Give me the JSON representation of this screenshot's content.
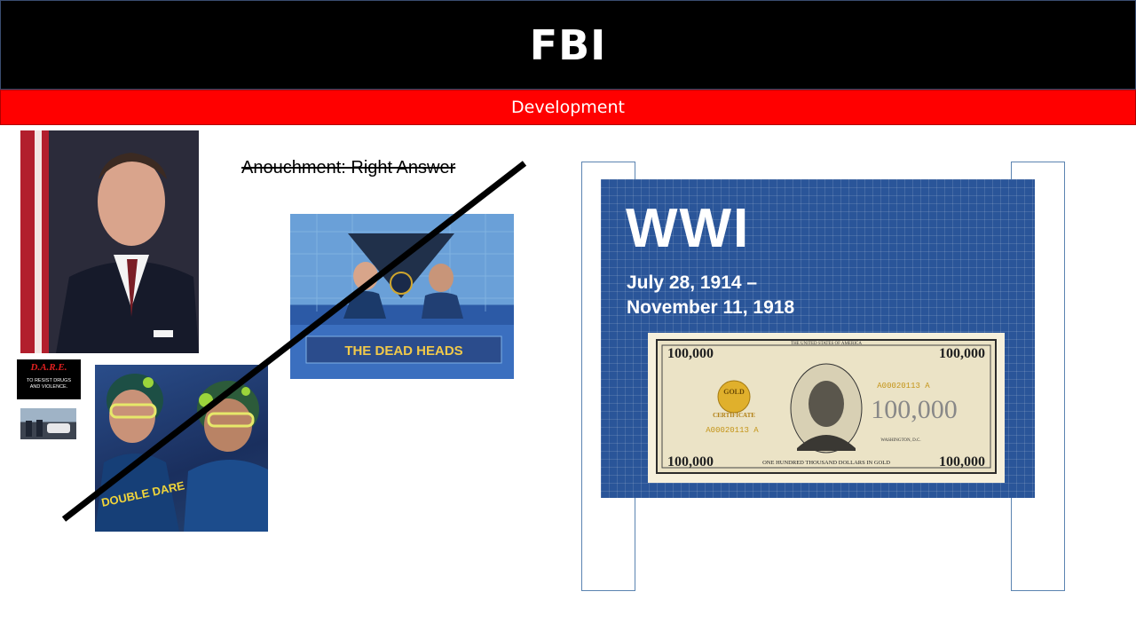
{
  "header": {
    "title": "FBI"
  },
  "subheader": {
    "label": "Development"
  },
  "left": {
    "announcement": "Anouchment: Right Answer",
    "dare_logo": {
      "brand": "D.A.R.E.",
      "line1": "TO RESIST DRUGS",
      "line2": "AND VIOLENCE."
    },
    "game_show_sign": "THE DEAD HEADS",
    "double_dare_shirt": "DOUBLE DARE"
  },
  "board": {
    "title": "WWI",
    "dates_line1": "July 28, 1914 –",
    "dates_line2": "November 11, 1918",
    "bill": {
      "denomination": "100,000",
      "serial": "A00020113 A",
      "label_gold": "GOLD",
      "label_cert": "CERTIFICATE",
      "bottom_text": "ONE HUNDRED THOUSAND DOLLARS IN GOLD",
      "top_text": "THE UNITED STATES OF AMERICA",
      "city": "WASHINGTON, D.C."
    }
  },
  "colors": {
    "header_bg": "#000000",
    "subheader_bg": "#ff0000",
    "board_bg": "#2a5599",
    "post_border": "#5b84b1"
  }
}
